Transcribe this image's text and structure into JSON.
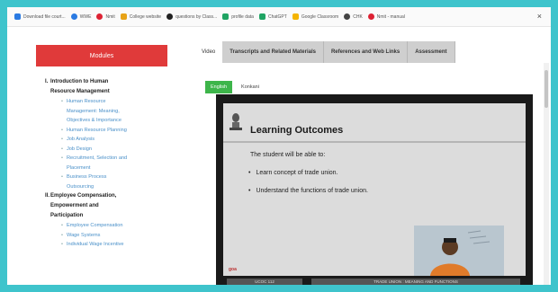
{
  "bookmarks": [
    {
      "label": "Download file court...",
      "icon": "download-icon",
      "color": "#2a7ae2"
    },
    {
      "label": "WWE",
      "icon": "globe-icon",
      "color": "#2a7ae2"
    },
    {
      "label": "Nmit",
      "icon": "pin-icon",
      "color": "#d23"
    },
    {
      "label": "College website",
      "icon": "college-icon",
      "color": "#e8a317"
    },
    {
      "label": "questions by Class...",
      "icon": "question-icon",
      "color": "#222"
    },
    {
      "label": "profile data",
      "icon": "sheet-icon",
      "color": "#1fa463"
    },
    {
      "label": "ChatGPT",
      "icon": "sheet-icon",
      "color": "#1fa463"
    },
    {
      "label": "Google Classroom",
      "icon": "classroom-icon",
      "color": "#f4b400"
    },
    {
      "label": "CHK",
      "icon": "chrome-icon",
      "color": "#444"
    },
    {
      "label": "Nmit - manual",
      "icon": "pin-icon",
      "color": "#d23"
    }
  ],
  "sidebar": {
    "header": "Modules",
    "sections": [
      {
        "num": "I.",
        "title": [
          "Introduction to Human",
          "Resource Management"
        ],
        "items": [
          [
            "Human Resource",
            "Management: Meaning,",
            "Objectives & Importance"
          ],
          [
            "Human Resource Planning"
          ],
          [
            "Job Analysis"
          ],
          [
            "Job Design"
          ],
          [
            "Recruitment, Selection and",
            "Placement"
          ],
          [
            "Business Process",
            "Outsourcing"
          ]
        ]
      },
      {
        "num": "II.",
        "title": [
          "Employee Compensation,",
          "Empowerment and",
          "Participation"
        ],
        "items": [
          [
            "Employee Compensation"
          ],
          [
            "Wage Systems"
          ],
          [
            "Individual Wage Incentive"
          ]
        ]
      }
    ]
  },
  "tabs": [
    {
      "label": "Video",
      "active": true
    },
    {
      "label": "Transcripts and Related Materials",
      "active": false
    },
    {
      "label": "References and Web Links",
      "active": false
    },
    {
      "label": "Assessment",
      "active": false
    }
  ],
  "languages": {
    "selected": "English",
    "other": "Konkani"
  },
  "video": {
    "slide_title": "Learning Outcomes",
    "intro": "The student will be able to:",
    "bullets": [
      "Learn concept of trade union.",
      "Understand the functions of trade union."
    ],
    "footer_left": "UCOC 112",
    "footer_right": "TRADE UNION : MEANING AND FUNCTIONS",
    "logo_text": "goa"
  }
}
